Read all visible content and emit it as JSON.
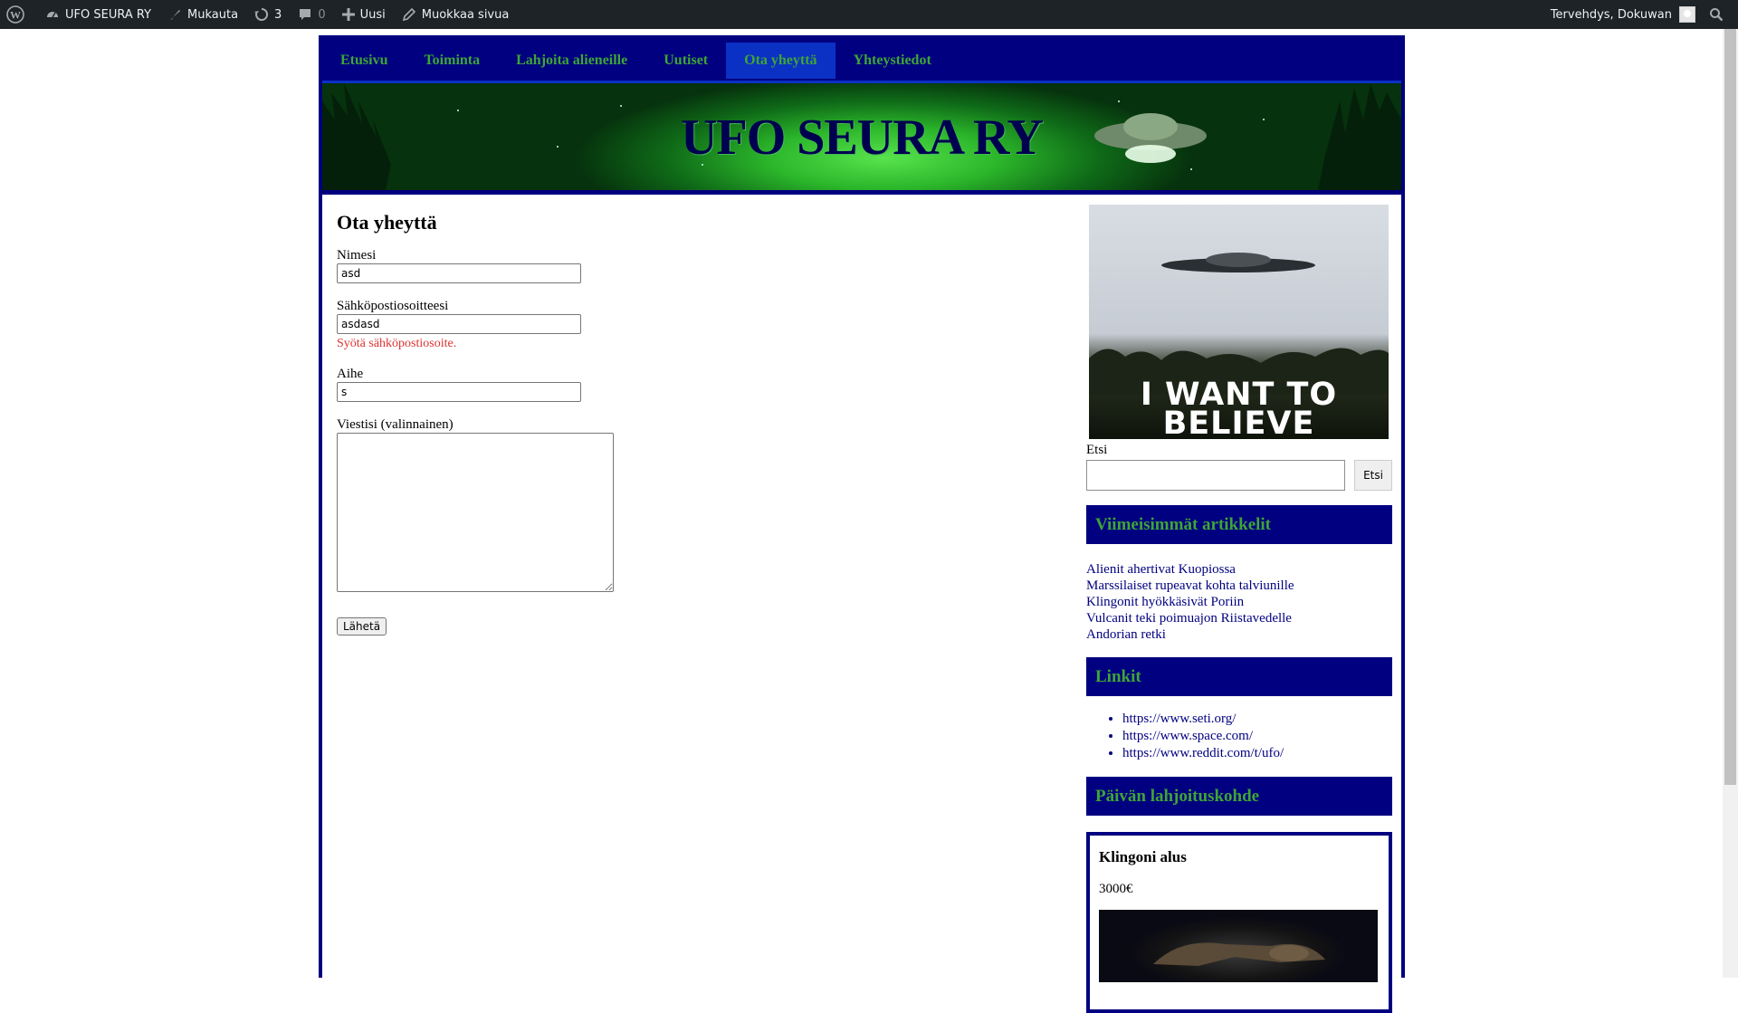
{
  "admin_bar": {
    "site_name": "UFO SEURA RY",
    "customize": "Mukauta",
    "updates_count": "3",
    "comments_count": "0",
    "new": "Uusi",
    "edit_page": "Muokkaa sivua",
    "greeting": "Tervehdys, Dokuwan"
  },
  "nav": {
    "items": [
      "Etusivu",
      "Toiminta",
      "Lahjoita alieneille",
      "Uutiset",
      "Ota yheyttä",
      "Yhteystiedot"
    ],
    "active_index": 4
  },
  "header": {
    "title": "UFO SEURA RY"
  },
  "colors": {
    "nav_bg": "#000080",
    "nav_text": "#3fa535",
    "nav_active": "#0b31c4",
    "error": "#dc3232",
    "link": "#000080"
  },
  "form": {
    "page_title": "Ota yheyttä",
    "name_label": "Nimesi",
    "name_value": "asd",
    "email_label": "Sähköpostiosoitteesi",
    "email_value": "asdasd",
    "email_error": "Syötä sähköpostiosoite.",
    "subject_label": "Aihe",
    "subject_value": "s",
    "message_label": "Viestisi (valinnainen)",
    "message_value": "",
    "submit_label": "Lähetä"
  },
  "sidebar": {
    "poster_line1": "I WANT TO",
    "poster_line2": "BELIEVE",
    "search_label": "Etsi",
    "search_button": "Etsi",
    "recent_title": "Viimeisimmät artikkelit",
    "recent_posts": [
      "Alienit ahertivat Kuopiossa",
      "Marssilaiset rupeavat kohta talviunille",
      "Klingonit hyökkäsivät Poriin",
      "Vulcanit teki poimuajon Riistavedelle",
      "Andorian retki"
    ],
    "links_title": "Linkit",
    "links": [
      "https://www.seti.org/",
      "https://www.space.com/",
      "https://www.reddit.com/t/ufo/"
    ],
    "donation_title": "Päivän lahjoituskohde",
    "donation_item": "Klingoni alus",
    "donation_price": "3000€"
  }
}
